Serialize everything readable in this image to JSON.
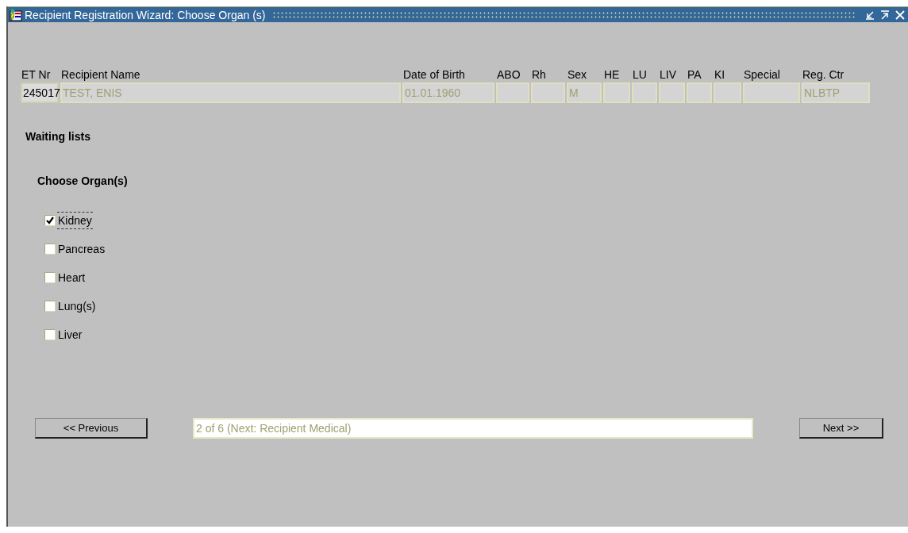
{
  "window": {
    "title": "Recipient Registration Wizard: Choose Organ (s)"
  },
  "header_fields": [
    {
      "label": "ET Nr",
      "value": "245017",
      "disabled": false
    },
    {
      "label": "Recipient Name",
      "value": "TEST, ENIS",
      "disabled": true
    },
    {
      "label": "Date of Birth",
      "value": "01.01.1960",
      "disabled": true
    },
    {
      "label": "ABO",
      "disabled": true
    },
    {
      "label": "Rh",
      "disabled": true
    },
    {
      "label": "Sex",
      "value": "M",
      "disabled": true
    },
    {
      "label": "HE",
      "disabled": true
    },
    {
      "label": "LU",
      "disabled": true
    },
    {
      "label": "LIV",
      "disabled": true
    },
    {
      "label": "PA",
      "disabled": true
    },
    {
      "label": "KI",
      "disabled": true
    },
    {
      "label": "Special",
      "disabled": true
    },
    {
      "label": "Reg. Ctr",
      "value": "NLBTP",
      "disabled": true
    }
  ],
  "section_title": "Waiting lists",
  "subsection_title": "Choose Organ(s)",
  "organs": [
    {
      "label": "Kidney",
      "checked": true,
      "focused": true
    },
    {
      "label": "Pancreas",
      "checked": false,
      "focused": false
    },
    {
      "label": "Heart",
      "checked": false,
      "focused": false
    },
    {
      "label": "Lung(s)",
      "checked": false,
      "focused": false
    },
    {
      "label": "Liver",
      "checked": false,
      "focused": false
    }
  ],
  "navigation": {
    "previous": "<< Previous",
    "status": "2 of 6 (Next: Recipient Medical)",
    "next": "Next >>"
  }
}
